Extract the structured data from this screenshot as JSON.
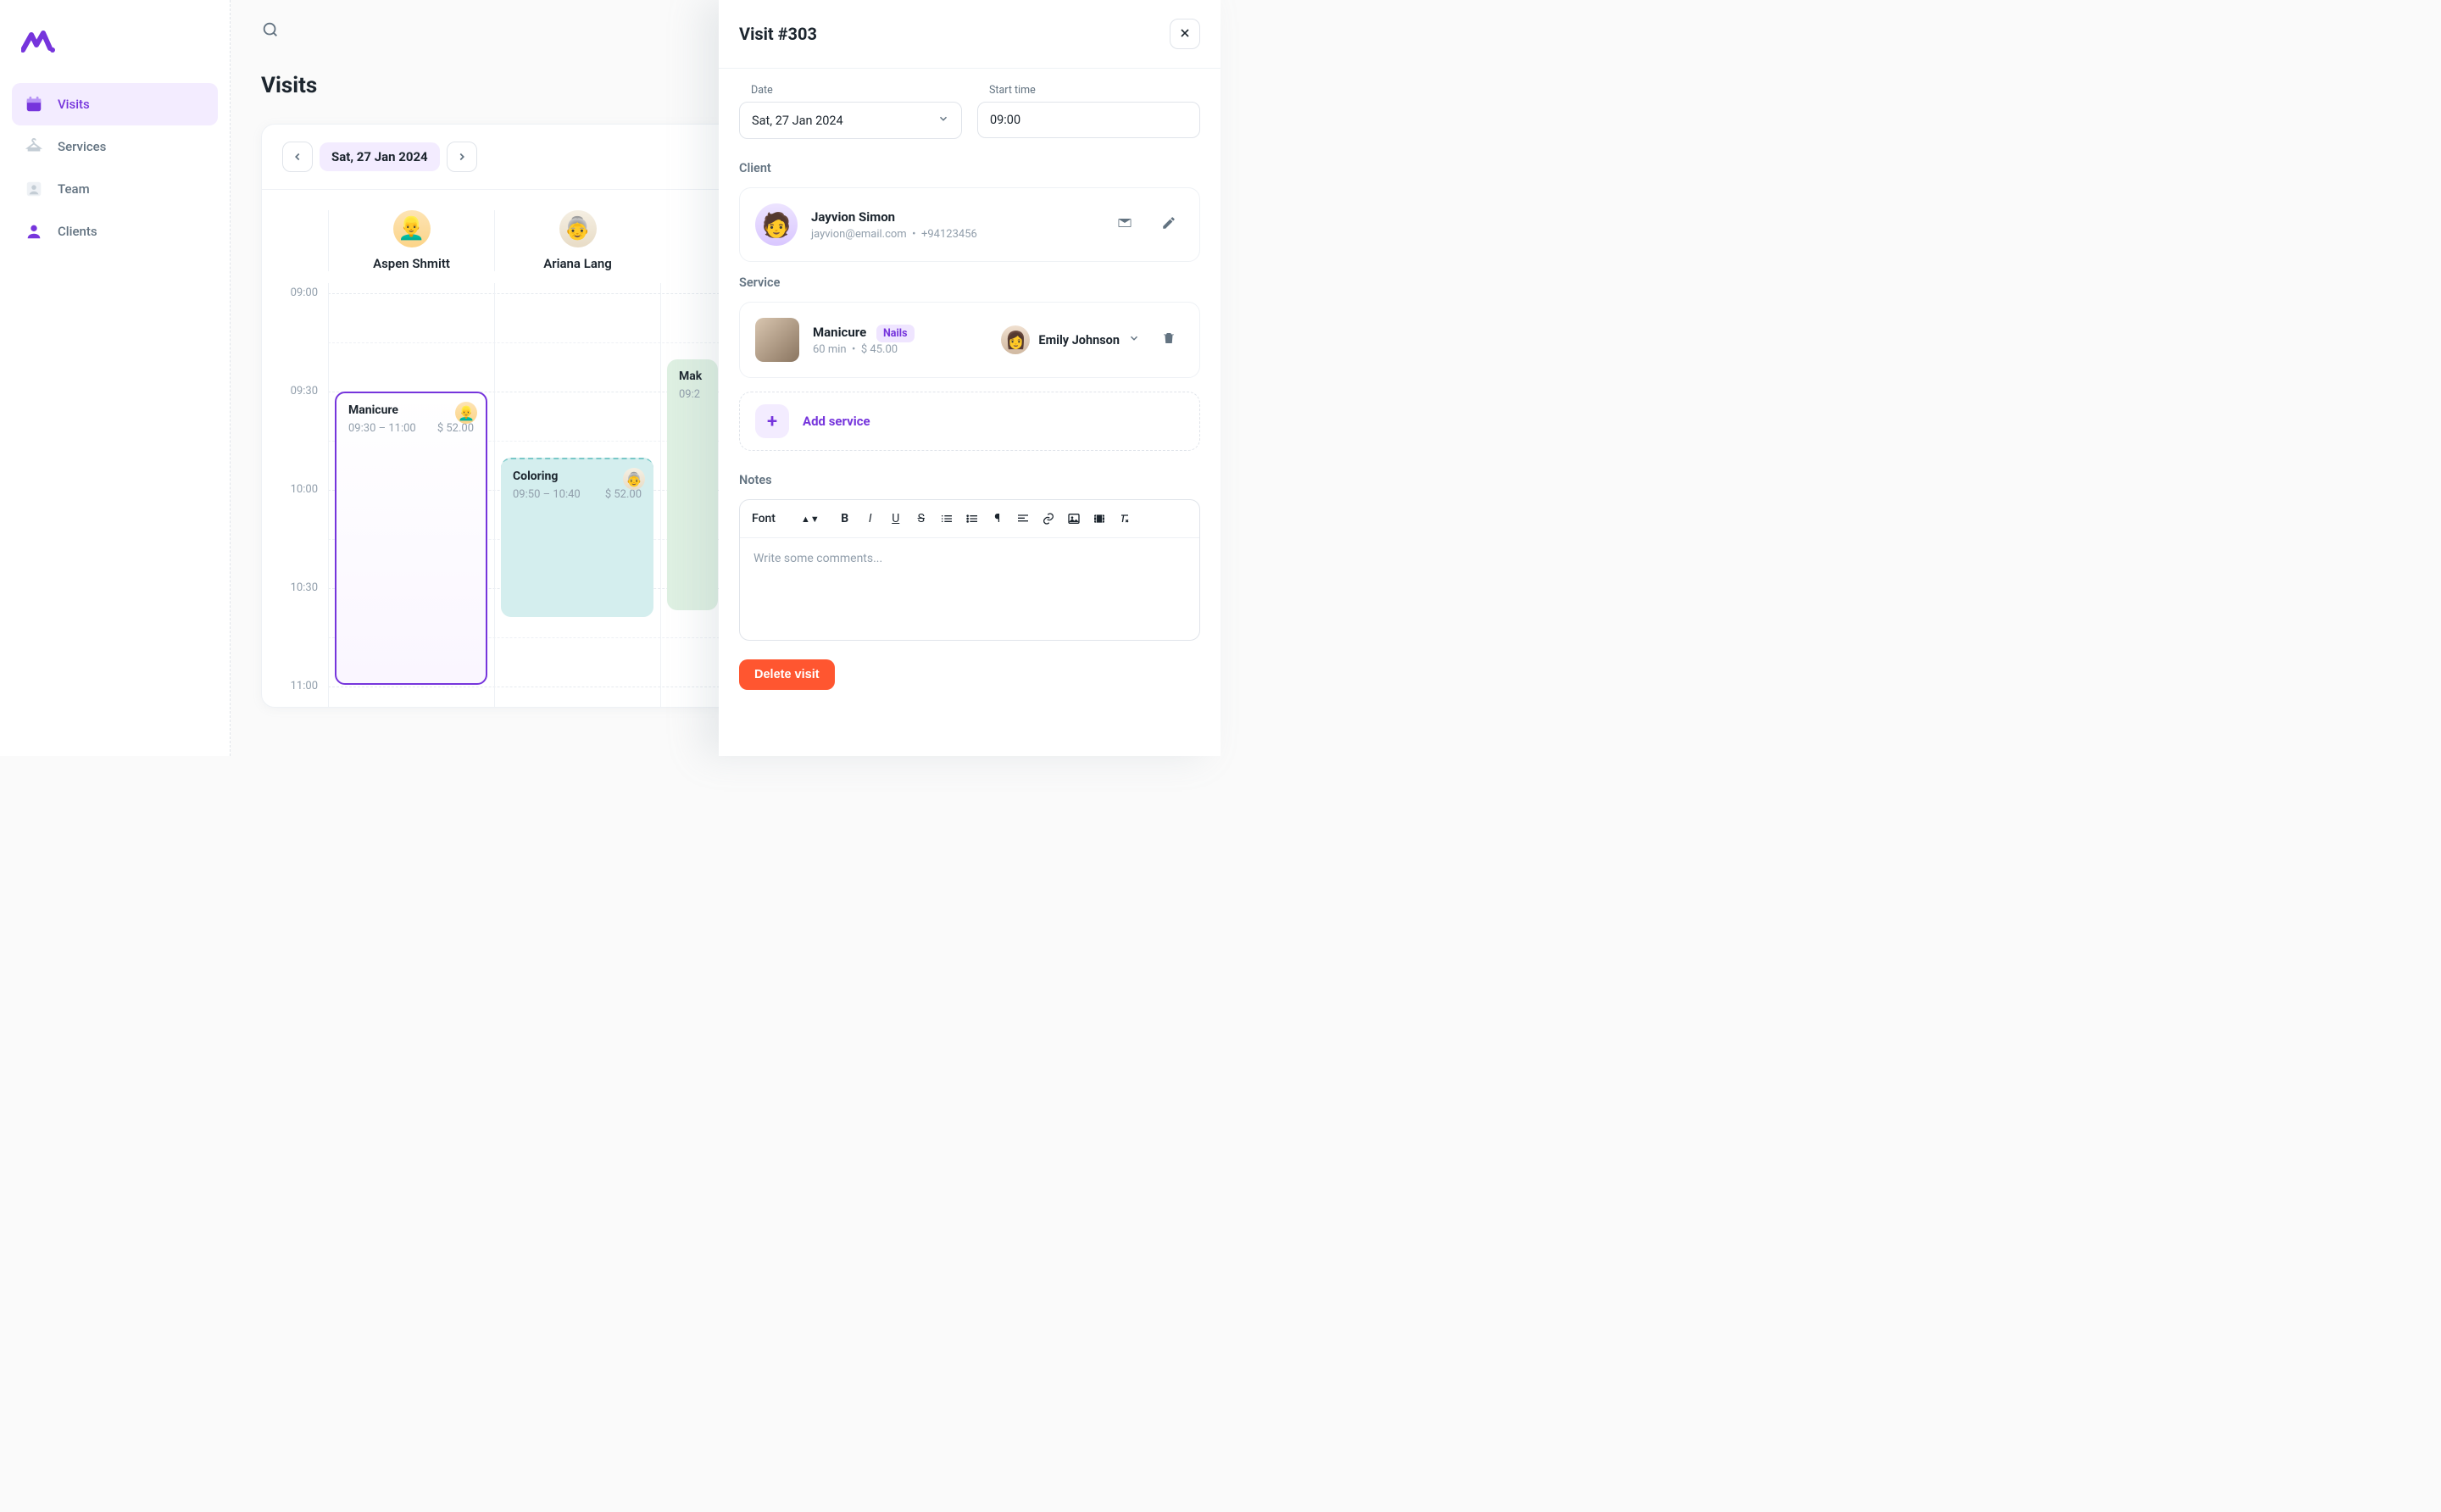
{
  "nav": {
    "items": [
      {
        "label": "Visits"
      },
      {
        "label": "Services"
      },
      {
        "label": "Team"
      },
      {
        "label": "Clients"
      }
    ]
  },
  "page": {
    "title": "Visits"
  },
  "calendar": {
    "date": "Sat, 27 Jan 2024",
    "staff": [
      {
        "name": "Aspen Shmitt"
      },
      {
        "name": "Ariana Lang"
      }
    ],
    "timeLabels": [
      "09:00",
      "09:30",
      "10:00",
      "10:30",
      "11:00"
    ],
    "events": {
      "manicure": {
        "title": "Manicure",
        "time": "09:30 – 11:00",
        "price": "$ 52.00"
      },
      "coloring": {
        "title": "Coloring",
        "time": "09:50 – 10:40",
        "price": "$ 52.00"
      },
      "makeup": {
        "title": "Mak",
        "time": "09:2"
      }
    }
  },
  "drawer": {
    "title": "Visit #303",
    "dateLabel": "Date",
    "dateValue": "Sat, 27 Jan 2024",
    "startLabel": "Start time",
    "startValue": "09:00",
    "clientLabel": "Client",
    "client": {
      "name": "Jayvion Simon",
      "email": "jayvion@email.com",
      "sep": "•",
      "phone": "+94123456"
    },
    "serviceLabel": "Service",
    "service": {
      "name": "Manicure",
      "tag": "Nails",
      "duration": "60 min",
      "sep": "•",
      "price": "$ 45.00",
      "assignee": "Emily Johnson"
    },
    "addService": "Add service",
    "notesLabel": "Notes",
    "fontLabel": "Font",
    "notesPlaceholder": "Write some comments...",
    "deleteLabel": "Delete visit"
  }
}
